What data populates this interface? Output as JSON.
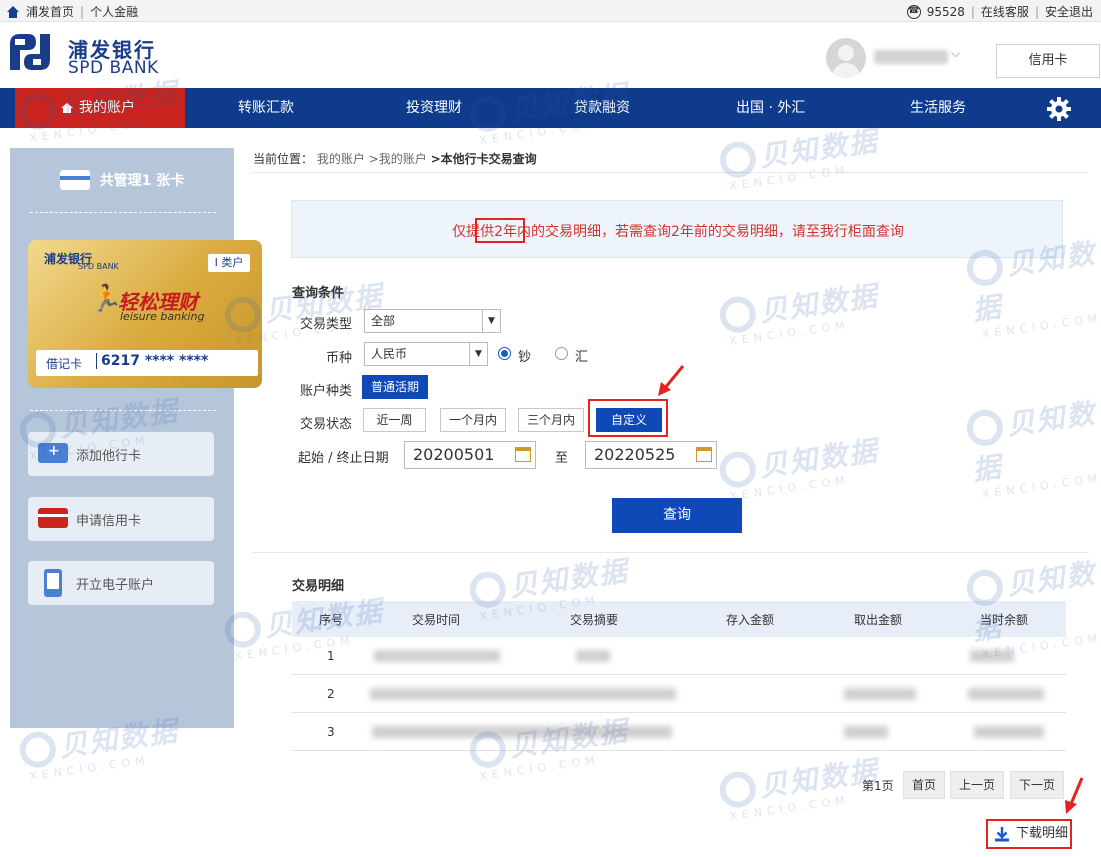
{
  "topbar": {
    "home": "浦发首页",
    "personal": "个人金融",
    "hotline": "95528",
    "online_service": "在线客服",
    "logout": "安全退出"
  },
  "header": {
    "bank_name_cn": "浦发银行",
    "bank_name_en": "SPD BANK",
    "credit_card_button": "信用卡"
  },
  "nav": {
    "items": [
      {
        "label": "我的账户",
        "active": true
      },
      {
        "label": "转账汇款"
      },
      {
        "label": "投资理财"
      },
      {
        "label": "贷款融资"
      },
      {
        "label": "出国 · 外汇"
      },
      {
        "label": "生活服务"
      }
    ]
  },
  "sidebar": {
    "card_count_label": "共管理1 张卡",
    "card": {
      "bank_cn": "浦发银行",
      "bank_en": "SPD BANK",
      "class_badge": "I 类户",
      "product_cn": "轻松理财",
      "product_en": "leisure banking",
      "card_type": "借记卡",
      "card_number": "6217 **** ****"
    },
    "buttons": [
      {
        "label": "添加他行卡"
      },
      {
        "label": "申请信用卡"
      },
      {
        "label": "开立电子账户"
      }
    ]
  },
  "breadcrumb": {
    "prefix": "当前位置：",
    "level1": "我的账户",
    "level2": ">我的账户",
    "current": ">本他行卡交易查询"
  },
  "notice": {
    "text": "仅提供2年内的交易明细，若需查询2年前的交易明细，请至我行柜面查询"
  },
  "query": {
    "section_title": "查询条件",
    "tx_type_label": "交易类型",
    "tx_type_value": "全部",
    "currency_label": "币种",
    "currency_value": "人民币",
    "cash_option": "钞",
    "remit_option": "汇",
    "account_type_label": "账户种类",
    "account_type_value": "普通活期",
    "status_label": "交易状态",
    "periods": [
      {
        "label": "近一周"
      },
      {
        "label": "一个月内"
      },
      {
        "label": "三个月内"
      },
      {
        "label": "自定义",
        "active": true
      }
    ],
    "date_label": "起始 / 终止日期",
    "start_date": "20200501",
    "to_label": "至",
    "end_date": "20220525",
    "submit": "查询"
  },
  "details": {
    "section_title": "交易明细",
    "columns": [
      "序号",
      "交易时间",
      "交易摘要",
      "存入金额",
      "取出金额",
      "当时余额"
    ],
    "rows": [
      {
        "no": "1"
      },
      {
        "no": "2"
      },
      {
        "no": "3"
      }
    ]
  },
  "pager": {
    "current_page": "第1页",
    "first": "首页",
    "prev": "上一页",
    "next": "下一页"
  },
  "download_button": "下载明细",
  "watermark": {
    "cn": "贝知数据",
    "en": "XENCIO.COM"
  },
  "colors": {
    "nav_blue": "#0f3b8c",
    "active_red": "#c9241e",
    "primary_button": "#0f49b8",
    "notice_text": "#d0342c",
    "highlight_box": "#e52420"
  }
}
